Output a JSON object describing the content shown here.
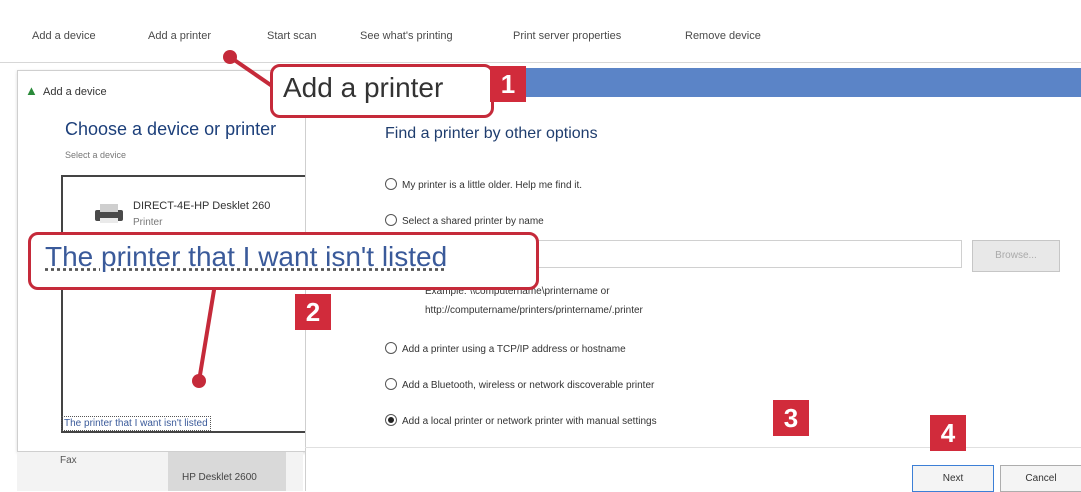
{
  "toolbar": {
    "items": [
      "Add a device",
      "Add a printer",
      "Start scan",
      "See what's printing",
      "Print server properties",
      "Remove device"
    ]
  },
  "device_window": {
    "title": "Add a device",
    "heading": "Choose a device or printer",
    "subheading": "Select a device",
    "device_name": "DIRECT-4E-HP Desklet 260",
    "device_type": "Printer",
    "not_listed_link": "The printer that I want isn't listed",
    "thumb_fax": "Fax",
    "thumb_hp": "HP Desklet 2600"
  },
  "dialog": {
    "heading": "Find a printer by other options",
    "options": [
      "My printer is a little older. Help me find it.",
      "Select a shared printer by name",
      "Add a printer using a TCP/IP address or hostname",
      "Add a Bluetooth, wireless or network discoverable printer",
      "Add a local printer or network printer with manual settings"
    ],
    "selected_option": 4,
    "browse_label": "Browse...",
    "example_line1": "Example: \\\\computername\\printername or",
    "example_line2": "http://computername/printers/printername/.printer",
    "next_label": "Next",
    "cancel_label": "Cancel"
  },
  "callouts": {
    "add_printer": "Add a printer",
    "not_listed": "The printer that I want isn't listed",
    "steps": [
      "1",
      "2",
      "3",
      "4"
    ]
  },
  "colors": {
    "callout_red": "#c52a3a",
    "badge_red": "#d12b3b",
    "title_bar_blue": "#5b84c7",
    "link_blue": "#3a5a9a"
  }
}
